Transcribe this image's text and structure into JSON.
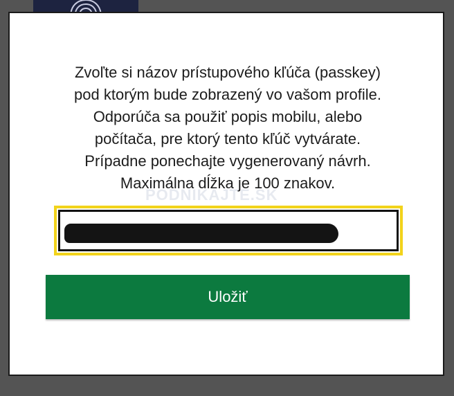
{
  "dialog": {
    "message_lines": [
      "Zvoľte si názov prístupového kľúča (passkey)",
      "pod ktorým bude zobrazený vo vašom profile.",
      "Odporúča sa použiť popis mobilu, alebo",
      "počítača, pre ktorý tento kľúč vytvárate.",
      "Prípadne ponechajte vygenerovaný návrh.",
      "Maximálna dĺžka je 100 znakov."
    ],
    "input": {
      "value": ""
    },
    "save_label": "Uložiť"
  },
  "watermark": "PODNIKAJTE.SK",
  "colors": {
    "overlay": "#545454",
    "dialog_bg": "#ffffff",
    "focus_ring": "#f2d31b",
    "button_bg": "#0c7a3f",
    "button_text": "#ffffff",
    "text": "#1c1c1c"
  },
  "icons": {
    "backdrop": "fingerprint-icon"
  }
}
